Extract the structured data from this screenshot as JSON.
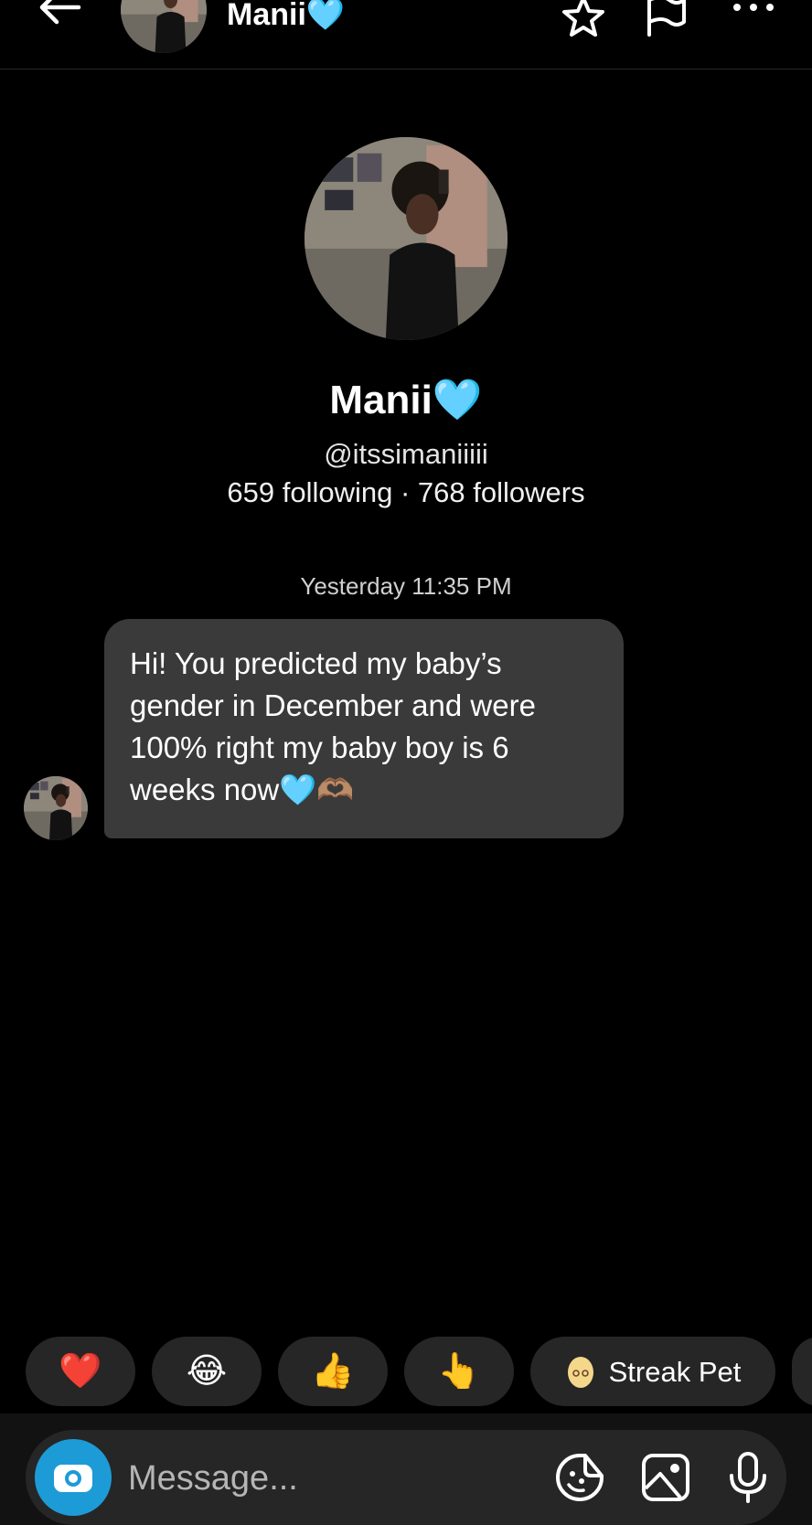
{
  "header": {
    "name": "Manii",
    "name_emoji": "🩵",
    "icons": [
      "back-arrow-icon",
      "star-icon",
      "flag-icon",
      "more-icon"
    ]
  },
  "profile": {
    "name": "Manii",
    "name_emoji": "🩵",
    "handle": "@itssimaniiiii",
    "stats": "659 following · 768 followers"
  },
  "thread": {
    "timestamp": "Yesterday 11:35 PM",
    "messages": [
      {
        "text": "Hi! You predicted my baby’s gender in December and were 100% right my baby boy is 6 weeks now🩵🫶🏽"
      }
    ]
  },
  "reactions": [
    {
      "emoji": "❤️"
    },
    {
      "emoji": "😂"
    },
    {
      "emoji": "👍"
    },
    {
      "emoji": "👆"
    },
    {
      "label": "Streak Pet",
      "icon": "egg-icon"
    }
  ],
  "composer": {
    "placeholder": "Message...",
    "icons": [
      "camera-icon",
      "sticker-icon",
      "gallery-icon",
      "microphone-icon"
    ]
  },
  "colors": {
    "background": "#000000",
    "bubble": "#3a3a3a",
    "chip": "#262626",
    "camera_button": "#1d9bd6",
    "accent_heart": "#5ad7f0"
  }
}
